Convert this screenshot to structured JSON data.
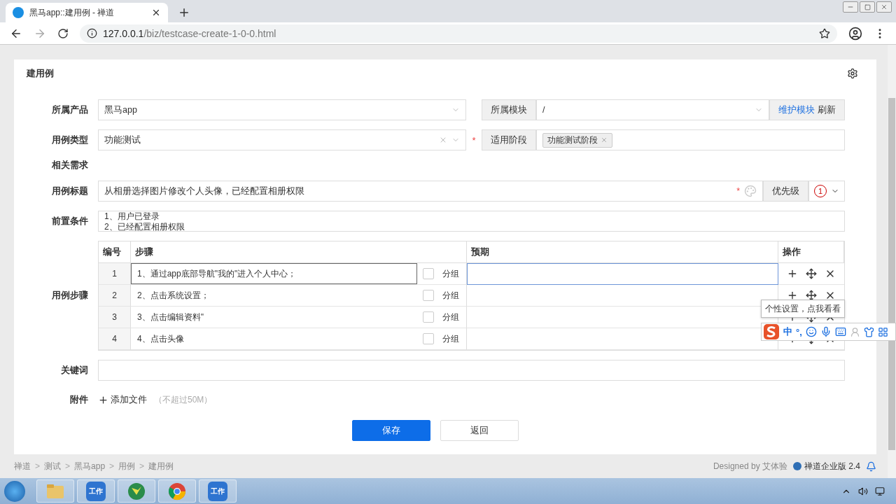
{
  "browser": {
    "tab_title": "黑马app::建用例 - 禅道",
    "url_host": "127.0.0.1",
    "url_path": "/biz/testcase-create-1-0-0.html"
  },
  "page": {
    "title": "建用例"
  },
  "product": {
    "label": "所属产品",
    "value": "黑马app"
  },
  "module": {
    "label": "所属模块",
    "value": "/",
    "link": "维护模块",
    "action": "刷新"
  },
  "type": {
    "label": "用例类型",
    "value": "功能测试",
    "required": true,
    "required_mark": "*"
  },
  "stage": {
    "label": "适用阶段",
    "tags": [
      "功能测试阶段"
    ]
  },
  "story": {
    "label": "相关需求"
  },
  "case_title": {
    "label": "用例标题",
    "value": "从相册选择图片修改个人头像，已经配置相册权限",
    "required": true,
    "required_mark": "*",
    "priority_label": "优先级",
    "priority": "1"
  },
  "precondition": {
    "label": "前置条件",
    "lines": [
      "1、用户已登录",
      "2、已经配置相册权限"
    ]
  },
  "steps": {
    "label": "用例步骤",
    "columns": [
      "编号",
      "步骤",
      "预期",
      "操作"
    ],
    "rows": [
      {
        "num": "1",
        "step": "1、通过app底部导航\"我的\"进入个人中心；",
        "group_label": "分组",
        "group_checked": false,
        "editing": true
      },
      {
        "num": "2",
        "step": "2、点击系统设置；",
        "group_label": "分组",
        "group_checked": false,
        "editing": false
      },
      {
        "num": "3",
        "step": "3、点击编辑资料\"",
        "group_label": "分组",
        "group_checked": false,
        "editing": false
      },
      {
        "num": "4",
        "step": "4、点击头像",
        "group_label": "分组",
        "group_checked": false,
        "editing": false
      }
    ]
  },
  "keywords": {
    "label": "关键词"
  },
  "attachment": {
    "label": "附件",
    "add": "添加文件",
    "hint": "（不超过50M）"
  },
  "buttons": [
    {
      "kind": "primary",
      "label": "保存"
    },
    {
      "kind": "default",
      "label": "返回"
    }
  ],
  "footer": {
    "separator": ">",
    "breadcrumb": [
      "禅道",
      "测试",
      "黑马app",
      "用例",
      "建用例"
    ],
    "designed": "Designed by 艾体验",
    "version": "禅道企业版 2.4"
  },
  "ime": {
    "tooltip": "个性设置，点我看看",
    "mode": "中",
    "punct": "°,"
  },
  "taskbar": [
    {
      "kind": "start"
    },
    {
      "kind": "folder"
    },
    {
      "kind": "work",
      "label": "工作"
    },
    {
      "kind": "app"
    },
    {
      "kind": "chrome"
    },
    {
      "kind": "work",
      "label": "工作"
    }
  ]
}
